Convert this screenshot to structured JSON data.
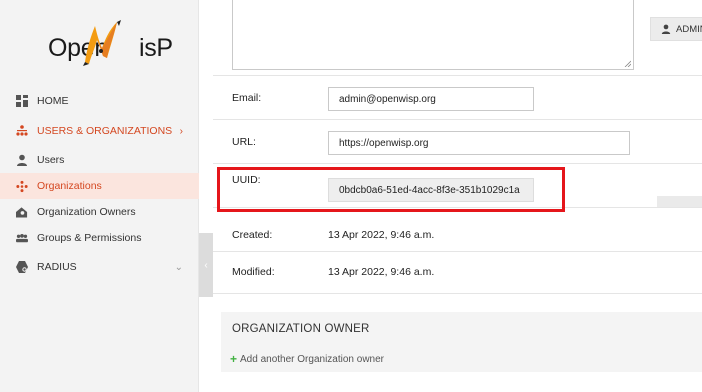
{
  "brand": {
    "logo_text_left": "Open",
    "logo_text_right": "isP"
  },
  "sidebar": {
    "items": [
      {
        "label": "HOME",
        "icon": "dashboard-icon"
      },
      {
        "label": "USERS & ORGANIZATIONS",
        "icon": "org-tree-icon",
        "caret": "›"
      },
      {
        "label": "Users",
        "icon": "user-icon"
      },
      {
        "label": "Organizations",
        "icon": "organizations-icon"
      },
      {
        "label": "Organization Owners",
        "icon": "owner-icon"
      },
      {
        "label": "Groups & Permissions",
        "icon": "groups-icon"
      },
      {
        "label": "RADIUS",
        "icon": "radius-icon",
        "caret": "⌄"
      }
    ],
    "toggle_glyph": "‹"
  },
  "header": {
    "user_button": "ADMIN"
  },
  "form": {
    "email_label": "Email:",
    "email_value": "admin@openwisp.org",
    "url_label": "URL:",
    "url_value": "https://openwisp.org",
    "uuid_label": "UUID:",
    "uuid_value": "0bdcb0a6-51ed-4acc-8f3e-351b1029c1a",
    "created_label": "Created:",
    "created_value": "13 Apr 2022, 9:46 a.m.",
    "modified_label": "Modified:",
    "modified_value": "13 Apr 2022, 9:46 a.m."
  },
  "owner_section": {
    "title": "ORGANIZATION OWNER",
    "add_label": "Add another Organization owner",
    "add_glyph": "+"
  },
  "colors": {
    "accent": "#d44720",
    "highlight": "#e5161b",
    "add_green": "#42b142"
  }
}
